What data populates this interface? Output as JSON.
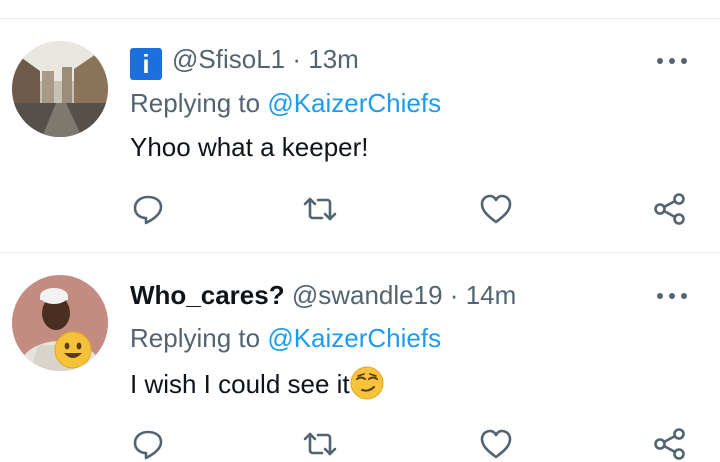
{
  "tweets": [
    {
      "badge_letter": "i",
      "display_name": "",
      "handle": "@SfisoL1",
      "separator": "·",
      "time": "13m",
      "replying_prefix": "Replying to",
      "replying_handle": "@KaizerChiefs",
      "text": "Yhoo what a keeper!",
      "emoji": "",
      "avatar": "city-street-photo",
      "actions": [
        "reply-icon",
        "retweet-icon",
        "like-icon",
        "share-icon"
      ]
    },
    {
      "badge_letter": "",
      "display_name": "Who_cares?",
      "handle": "@swandle19",
      "separator": "·",
      "time": "14m",
      "replying_prefix": "Replying to",
      "replying_handle": "@KaizerChiefs",
      "text": "I wish I could see it",
      "emoji": "smirking-face",
      "avatar": "person-photo-with-smiley",
      "actions": [
        "reply-icon",
        "retweet-icon",
        "like-icon",
        "share-icon"
      ]
    }
  ],
  "colors": {
    "link": "#1d9bf0",
    "secondary_text": "#536471",
    "divider": "#e6ecf0",
    "badge": "#1d6fe0"
  }
}
